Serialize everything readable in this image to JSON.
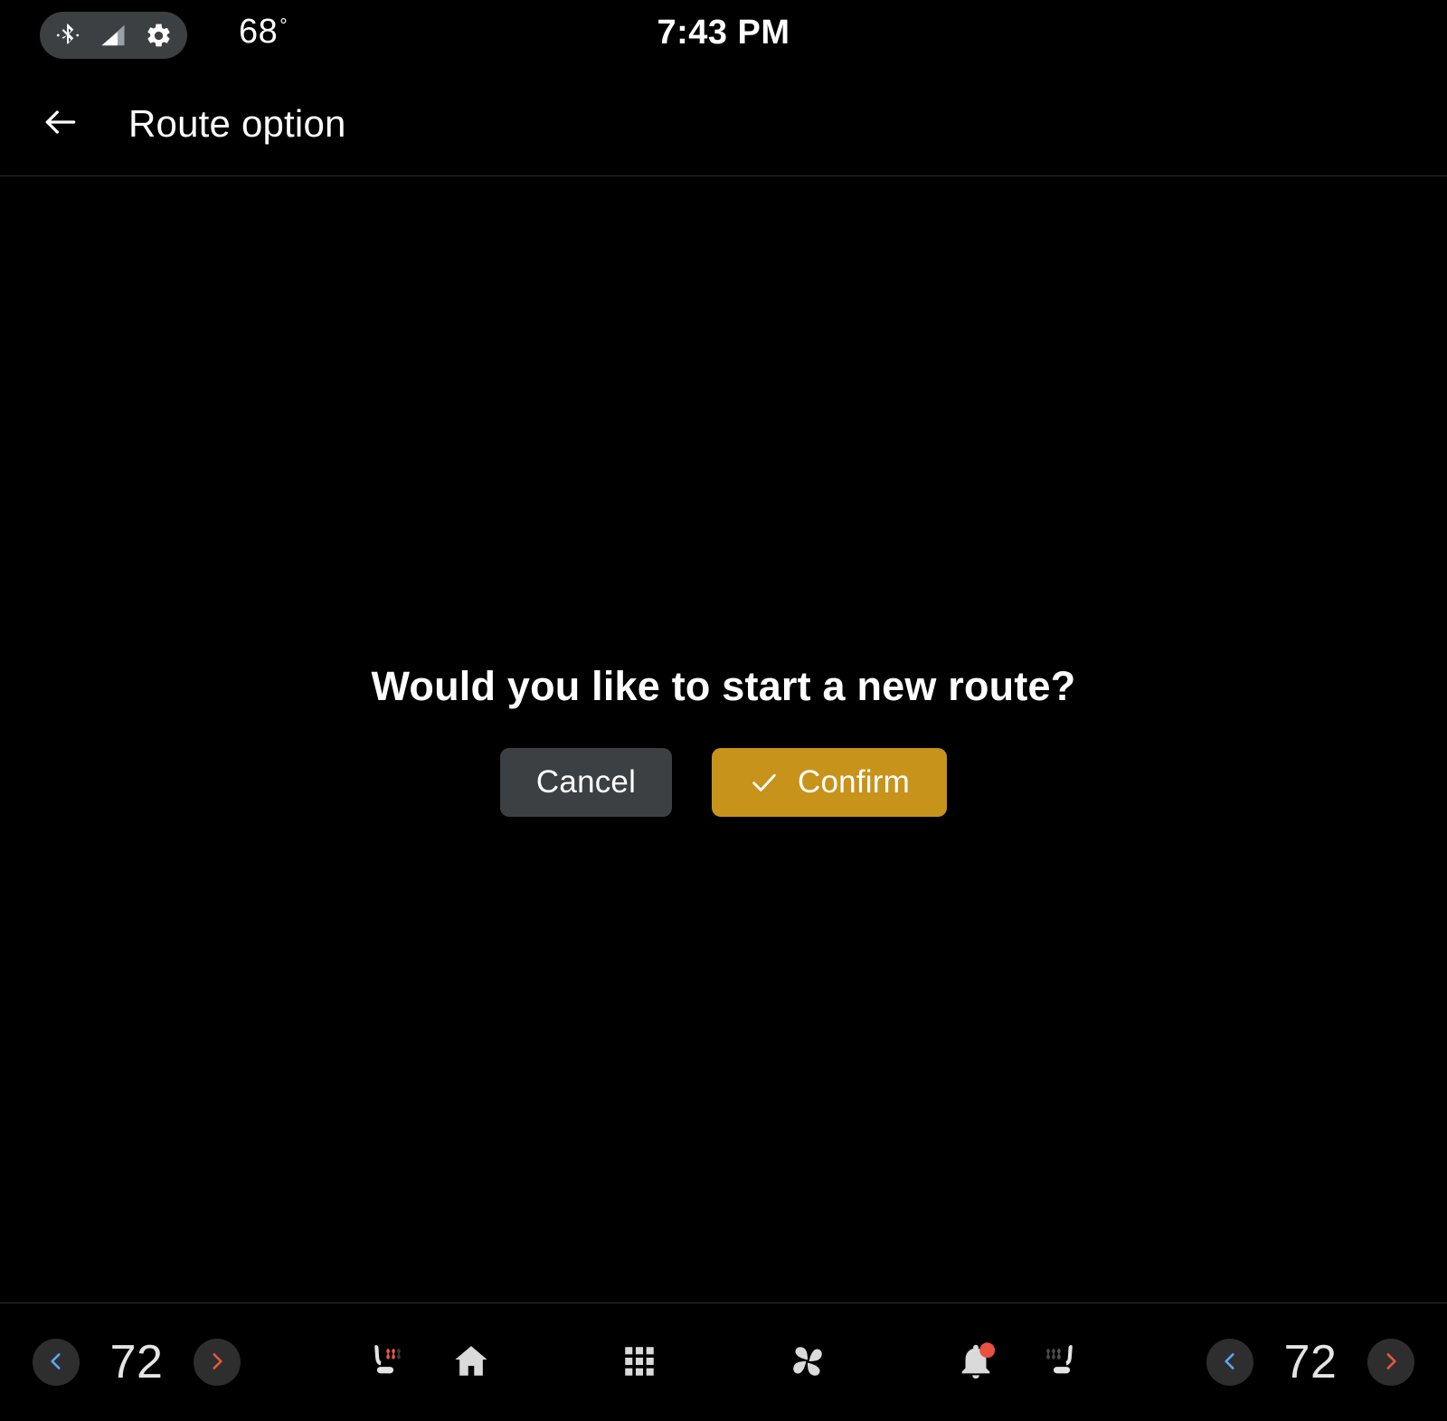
{
  "statusbar": {
    "bluetooth_icon": "bluetooth-icon",
    "signal_icon": "signal-bars-icon",
    "settings_icon": "gear-icon",
    "outside_temp": "68",
    "degree_symbol": "°",
    "clock": "7:43 PM"
  },
  "header": {
    "back_icon": "back-arrow-icon",
    "title": "Route option"
  },
  "dialog": {
    "message": "Would you like to start a new route?",
    "cancel_label": "Cancel",
    "confirm_label": "Confirm",
    "confirm_icon": "check-icon",
    "cancel_color": "#3C4043",
    "confirm_color": "#C8931A"
  },
  "bottombar": {
    "left_climate": {
      "decrease_icon": "chevron-left-icon",
      "temperature": "72",
      "increase_icon": "chevron-right-icon",
      "seat_heater_icon": "heated-seat-icon-driver",
      "seat_heater_active": true
    },
    "right_climate": {
      "seat_heater_icon": "heated-seat-icon-passenger",
      "seat_heater_active": false,
      "decrease_icon": "chevron-left-icon",
      "temperature": "72",
      "increase_icon": "chevron-right-icon"
    },
    "nav": [
      {
        "name": "home",
        "icon": "home-icon"
      },
      {
        "name": "apps",
        "icon": "apps-grid-icon"
      },
      {
        "name": "climate",
        "icon": "fan-icon"
      },
      {
        "name": "notifications",
        "icon": "bell-icon",
        "badge": true
      }
    ],
    "colors": {
      "chevron_cool": "#5BA7F0",
      "chevron_heat": "#E8573F",
      "badge": "#E8513F",
      "icon": "#DADADA"
    }
  }
}
